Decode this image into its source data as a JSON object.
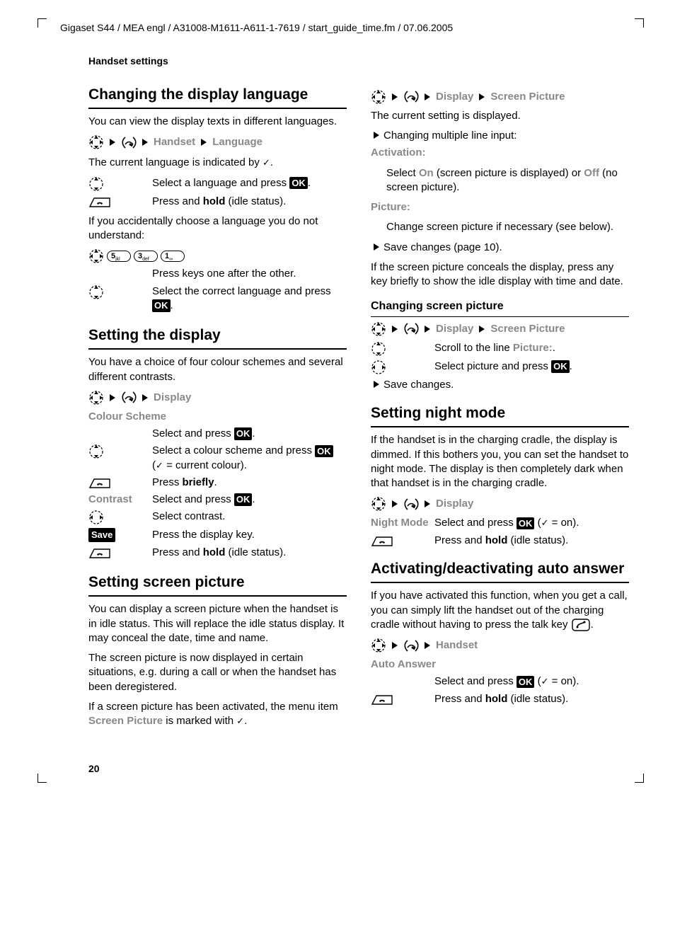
{
  "header": "Gigaset S44 / MEA engl / A31008-M1611-A611-1-7619 / start_guide_time.fm / 07.06.2005",
  "sectionTitle": "Handset settings",
  "pageNum": "20",
  "ok": "OK",
  "save": "Save",
  "left": {
    "h1": "Changing the display language",
    "p1": "You can view the display texts in different languages.",
    "path1a": "Handset",
    "path1b": "Language",
    "p2a": "The current language is indicated by ",
    "p2b": ".",
    "r1a": "Select a language and press ",
    "r1b": ".",
    "r2a": "Press and ",
    "r2b": "hold",
    "r2c": " (idle status).",
    "p3": "If you accidentally choose a language you do not understand:",
    "k1": "5",
    "k2": "3",
    "k3": "1",
    "r3": "Press keys one after the other.",
    "r4a": "Select the correct language and press ",
    "r4b": ".",
    "h2": "Setting the display",
    "p4": "You have a choice of four colour schemes and several different contrasts.",
    "path2": "Display",
    "cs": "Colour Scheme",
    "r5a": "Select and press ",
    "r5b": ".",
    "r6a": "Select a colour scheme and press ",
    "r6b": " (",
    "r6c": " = current colour).",
    "r7a": "Press ",
    "r7b": "briefly",
    "r7c": ".",
    "contrast": "Contrast",
    "r8a": "Select and press ",
    "r8b": ".",
    "r9": "Select contrast.",
    "r10": "Press the display key.",
    "r11a": "Press and ",
    "r11b": "hold",
    "r11c": " (idle status).",
    "h3": "Setting screen picture",
    "p5": "You can display a screen picture when the handset is in idle status. This will replace the idle status display. It may conceal the date, time and name.",
    "p6": "The screen picture is now displayed in certain situations, e.g. during a call or when the handset has been deregistered.",
    "p7a": "If a screen picture has been activated, the menu item ",
    "p7b": "Screen Picture",
    "p7c": " is marked with ",
    "p7d": "."
  },
  "right": {
    "path1a": "Display",
    "path1b": "Screen Picture",
    "p1": "The current setting is displayed.",
    "b1": "Changing multiple line input:",
    "act": "Activation:",
    "p2a": "Select ",
    "p2b": "On",
    "p2c": " (screen picture is displayed) or ",
    "p2d": "Off",
    "p2e": " (no screen picture).",
    "pic": "Picture:",
    "p3": "Change screen picture if necessary (see below).",
    "b2": "Save changes (page 10).",
    "p4": "If the screen picture conceals the display, press any key briefly to show the idle display with time and date.",
    "h1": "Changing screen picture",
    "path2a": "Display",
    "path2b": "Screen Picture",
    "r1a": "Scroll to the line ",
    "r1b": "Picture:",
    "r1c": ".",
    "r2a": "Select picture and press ",
    "r2b": ".",
    "b3": "Save changes.",
    "h2": "Setting night mode",
    "p5": "If the handset is in the charging cradle, the display is dimmed. If this bothers you, you can set the handset to night mode. The display is then completely dark when that handset is in the charging cradle.",
    "path3": "Display",
    "nm": "Night Mode",
    "r3a": "Select and press ",
    "r3b": " (",
    "r3c": " = on).",
    "r4a": "Press and ",
    "r4b": "hold",
    "r4c": " (idle status).",
    "h3": "Activating/deactivating auto answer",
    "p6a": "If you have activated this function, when you get a call, you can simply lift the handset out of the charging cradle without having to press the talk key ",
    "p6b": ".",
    "path4": "Handset",
    "aa": "Auto Answer",
    "r5a": "Select and press ",
    "r5b": " (",
    "r5c": " = on).",
    "r6a": "Press and ",
    "r6b": "hold",
    "r6c": " (idle status)."
  }
}
